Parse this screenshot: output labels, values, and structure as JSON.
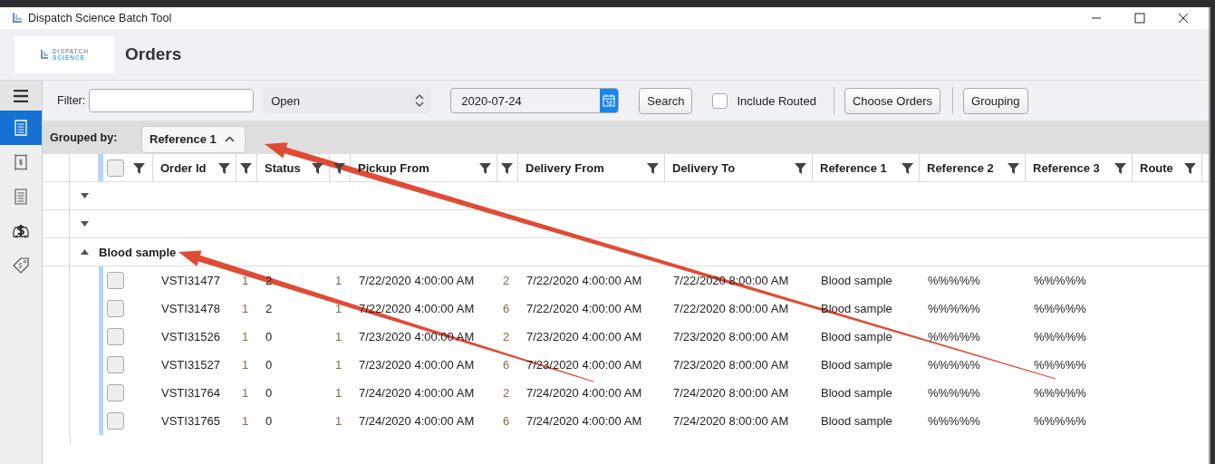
{
  "window": {
    "title": "Dispatch Science Batch Tool"
  },
  "header": {
    "logo_top": "DISPATCH",
    "logo_bottom": "SCIENCE",
    "title": "Orders"
  },
  "sidebar": {
    "items": [
      {
        "kind": "menu",
        "selected": false
      },
      {
        "kind": "orders",
        "selected": true
      },
      {
        "kind": "invoice",
        "selected": false
      },
      {
        "kind": "list",
        "selected": false
      },
      {
        "kind": "car-pay",
        "selected": false
      },
      {
        "kind": "tag",
        "selected": false
      }
    ]
  },
  "toolbar": {
    "filter_label": "Filter:",
    "status": "Open",
    "date": "2020-07-24",
    "search": "Search",
    "include_routed": {
      "label": "Include Routed",
      "checked": false
    },
    "buttons": [
      "Choose Orders",
      "Grouping"
    ]
  },
  "grouping": {
    "label": "Grouped by:",
    "chip": "Reference 1"
  },
  "table": {
    "columns": [
      {
        "kind": "text",
        "header": "Order Id"
      },
      {
        "kind": "narrow"
      },
      {
        "kind": "text",
        "header": "Status"
      },
      {
        "kind": "narrow"
      },
      {
        "kind": "text",
        "header": "Pickup From"
      },
      {
        "kind": "narrow"
      },
      {
        "kind": "text",
        "header": "Delivery From"
      },
      {
        "kind": "text",
        "header": "Delivery To"
      },
      {
        "kind": "text",
        "header": "Reference 1"
      },
      {
        "kind": "text",
        "header": "Reference 2"
      },
      {
        "kind": "text",
        "header": "Reference 3"
      },
      {
        "kind": "text",
        "header": "Route"
      }
    ],
    "header_checked": false,
    "groups": [
      {
        "expanded": false
      },
      {
        "expanded": false
      },
      {
        "label": "Blood sample",
        "expanded": true,
        "rows": [
          {
            "checked": false,
            "cells": [
              "VSTI31477",
              "1",
              "2",
              "1",
              "7/22/2020 4:00:00 AM",
              "2",
              "7/22/2020 4:00:00 AM",
              "7/22/2020 8:00:00 AM",
              "Blood sample",
              "%%%%%",
              "%%%%%",
              ""
            ]
          },
          {
            "checked": false,
            "cells": [
              "VSTI31478",
              "1",
              "2",
              "1",
              "7/22/2020 4:00:00 AM",
              "6",
              "7/22/2020 4:00:00 AM",
              "7/22/2020 8:00:00 AM",
              "Blood sample",
              "%%%%%",
              "%%%%%",
              ""
            ]
          },
          {
            "checked": false,
            "cells": [
              "VSTI31526",
              "1",
              "0",
              "1",
              "7/23/2020 4:00:00 AM",
              "2",
              "7/23/2020 4:00:00 AM",
              "7/23/2020 8:00:00 AM",
              "Blood sample",
              "%%%%%",
              "%%%%%",
              ""
            ]
          },
          {
            "checked": false,
            "cells": [
              "VSTI31527",
              "1",
              "0",
              "1",
              "7/23/2020 4:00:00 AM",
              "6",
              "7/23/2020 4:00:00 AM",
              "7/23/2020 8:00:00 AM",
              "Blood sample",
              "%%%%%",
              "%%%%%",
              ""
            ]
          },
          {
            "checked": false,
            "cells": [
              "VSTI31764",
              "1",
              "0",
              "1",
              "7/24/2020 4:00:00 AM",
              "2",
              "7/24/2020 4:00:00 AM",
              "7/24/2020 8:00:00 AM",
              "Blood sample",
              "%%%%%",
              "%%%%%",
              ""
            ]
          },
          {
            "checked": false,
            "cells": [
              "VSTI31765",
              "1",
              "0",
              "1",
              "7/24/2020 4:00:00 AM",
              "6",
              "7/24/2020 4:00:00 AM",
              "7/24/2020 8:00:00 AM",
              "Blood sample",
              "%%%%%",
              "%%%%%",
              ""
            ]
          }
        ]
      }
    ]
  }
}
